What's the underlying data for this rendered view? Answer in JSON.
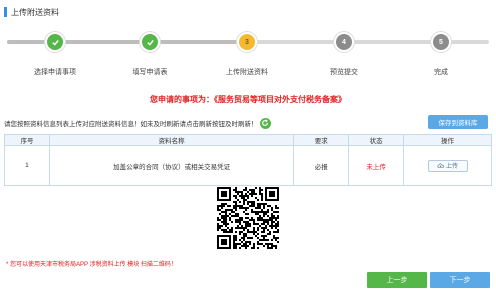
{
  "header": {
    "title": "上传附送资料"
  },
  "steps": [
    {
      "label": "选择申请事项",
      "state": "done",
      "number": ""
    },
    {
      "label": "填写申请表",
      "state": "done",
      "number": ""
    },
    {
      "label": "上传附送资料",
      "state": "current",
      "number": "3"
    },
    {
      "label": "预览提交",
      "state": "todo",
      "number": "4"
    },
    {
      "label": "完成",
      "state": "todo",
      "number": "5"
    }
  ],
  "notice": "您申请的事项为：《服务贸易等项目对外支付税务备案》",
  "hint": "请您按照资料信息列表上传对应附送资料信息！如未及时刷新请点击刷新按钮及时刷新！",
  "save_button": "保存到资料库",
  "table": {
    "headers": [
      "序号",
      "资料名称",
      "要求",
      "状态",
      "操作"
    ],
    "rows": [
      {
        "index": "1",
        "name": "加盖公章的合同（协议）或相关交易凭证",
        "requirement": "必报",
        "status": "未上传",
        "action": "上传"
      }
    ]
  },
  "qr_note": "* 您可以使用天津市税务局APP 涉税资料上传 模块 扫描二维码！",
  "footer": {
    "prev": "上一步",
    "next": "下一步"
  },
  "colors": {
    "accent": "#3a8ee6",
    "done": "#55b64a",
    "current": "#f4b930",
    "todo": "#8c8c8c",
    "error": "#e02020"
  }
}
